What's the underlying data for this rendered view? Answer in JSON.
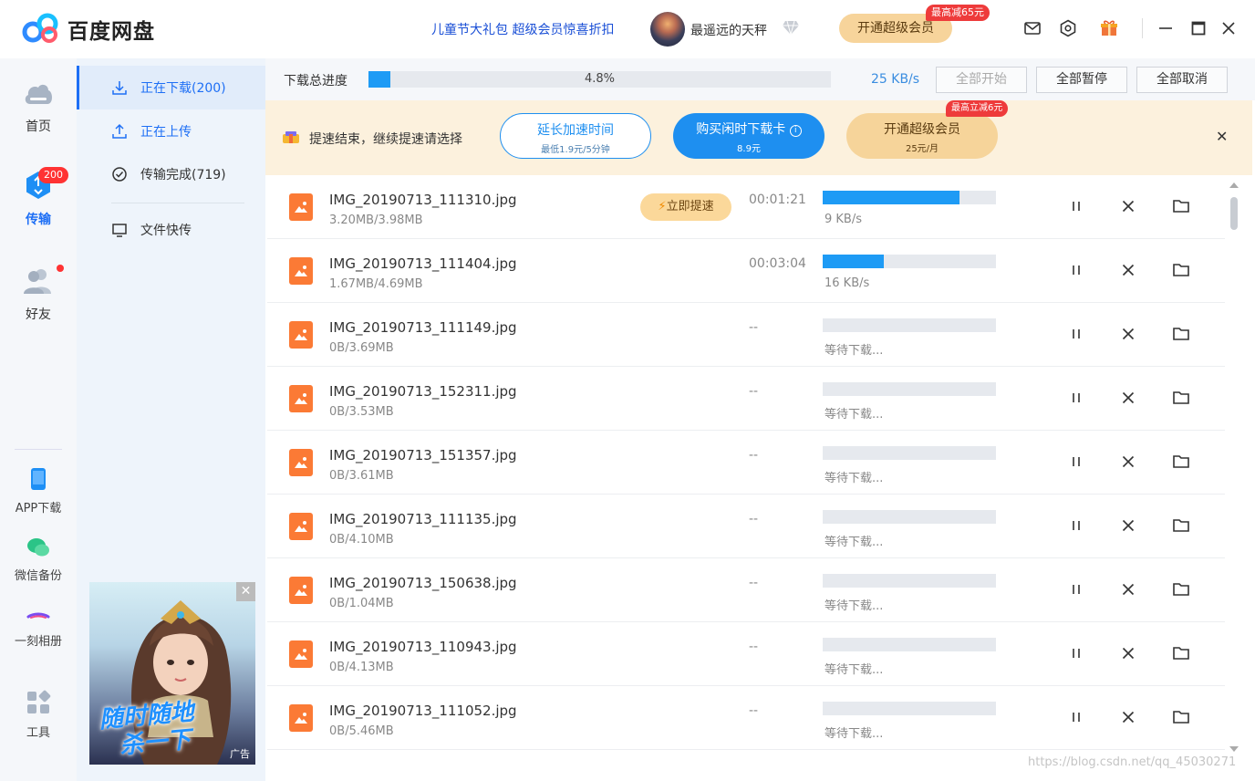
{
  "app": {
    "title": "百度网盘",
    "promo": "儿童节大礼包 超级会员惊喜折扣",
    "username": "最遥远的天秤",
    "vip_button": "开通超级会员",
    "vip_badge": "最高减65元"
  },
  "leftnav": {
    "items": [
      {
        "label": "首页",
        "icon": "cloud-icon"
      },
      {
        "label": "传输",
        "icon": "transfer-icon",
        "badge": "200"
      },
      {
        "label": "好友",
        "icon": "friends-icon"
      }
    ],
    "tools": [
      {
        "label": "APP下载",
        "icon": "phone-icon"
      },
      {
        "label": "微信备份",
        "icon": "wechat-icon"
      },
      {
        "label": "一刻相册",
        "icon": "album-icon"
      },
      {
        "label": "工具",
        "icon": "tools-icon"
      }
    ]
  },
  "subnav": {
    "downloading": "正在下载(200)",
    "uploading": "正在上传",
    "completed": "传输完成(719)",
    "quick_transfer": "文件快传"
  },
  "ad": {
    "slogan_1": "随时随地",
    "slogan_2": "杀一下",
    "tag": "广告",
    "close": "✕"
  },
  "toolbar": {
    "total_label": "下载总进度",
    "total_percent": "4.8%",
    "total_progress": 0.048,
    "speed": "25 KB/s",
    "start_all": "全部开始",
    "pause_all": "全部暂停",
    "cancel_all": "全部取消"
  },
  "banner": {
    "text": "提速结束，继续提速请选择",
    "extend_title": "延长加速时间",
    "extend_sub": "最低1.9元/5分钟",
    "buy_title": "购买闲时下载卡",
    "buy_sub": "8.9元",
    "vip_title": "开通超级会员",
    "vip_sub": "25元/月",
    "vip_badge": "最高立减6元",
    "close": "✕"
  },
  "files": [
    {
      "name": "IMG_20190713_111310.jpg",
      "size": "3.20MB/3.98MB",
      "eta": "00:01:21",
      "status": "9 KB/s",
      "progress": 0.79,
      "boost": "立即提速"
    },
    {
      "name": "IMG_20190713_111404.jpg",
      "size": "1.67MB/4.69MB",
      "eta": "00:03:04",
      "status": "16 KB/s",
      "progress": 0.35
    },
    {
      "name": "IMG_20190713_111149.jpg",
      "size": "0B/3.69MB",
      "eta": "--",
      "status": "等待下载...",
      "progress": 0
    },
    {
      "name": "IMG_20190713_152311.jpg",
      "size": "0B/3.53MB",
      "eta": "--",
      "status": "等待下载...",
      "progress": 0
    },
    {
      "name": "IMG_20190713_151357.jpg",
      "size": "0B/3.61MB",
      "eta": "--",
      "status": "等待下载...",
      "progress": 0
    },
    {
      "name": "IMG_20190713_111135.jpg",
      "size": "0B/4.10MB",
      "eta": "--",
      "status": "等待下载...",
      "progress": 0
    },
    {
      "name": "IMG_20190713_150638.jpg",
      "size": "0B/1.04MB",
      "eta": "--",
      "status": "等待下载...",
      "progress": 0
    },
    {
      "name": "IMG_20190713_110943.jpg",
      "size": "0B/4.13MB",
      "eta": "--",
      "status": "等待下载...",
      "progress": 0
    },
    {
      "name": "IMG_20190713_111052.jpg",
      "size": "0B/5.46MB",
      "eta": "--",
      "status": "等待下载...",
      "progress": 0
    }
  ],
  "watermark": "https://blog.csdn.net/qq_45030271",
  "colors": {
    "accent": "#1e6ff5",
    "progress": "#1e9bf5",
    "file_icon": "#fb7a35",
    "vip_gold": "#f7d49b",
    "badge_red": "#ee3b3b"
  }
}
